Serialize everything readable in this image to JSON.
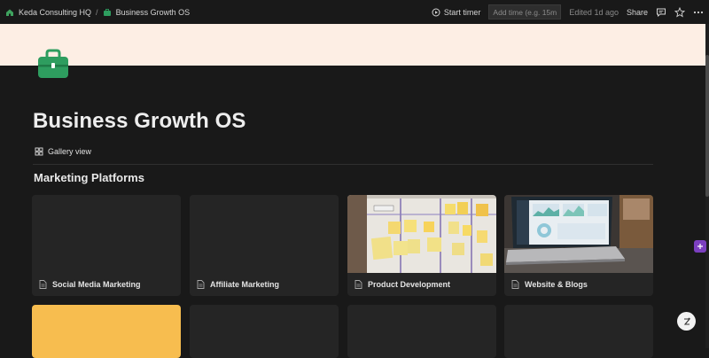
{
  "breadcrumb": {
    "workspace": "Keda Consulting HQ",
    "separator": "/",
    "page": "Business Growth OS"
  },
  "toolbar": {
    "start_timer": "Start timer",
    "time_placeholder": "Add time (e.g. 15m)",
    "edited": "Edited 1d ago",
    "share": "Share"
  },
  "page": {
    "title": "Business Growth OS",
    "view_label": "Gallery view",
    "section_title": "Marketing Platforms",
    "cover_color": "#fdeee4",
    "icon": "briefcase-icon",
    "icon_color": "#2e9d5f"
  },
  "cards": [
    {
      "title": "Social Media Marketing",
      "cover": "none"
    },
    {
      "title": "Affiliate Marketing",
      "cover": "none"
    },
    {
      "title": "Product Development",
      "cover": "whiteboard-sticky-notes-photo"
    },
    {
      "title": "Website & Blogs",
      "cover": "laptop-dashboard-photo"
    }
  ],
  "second_row": [
    {
      "cover_color": "#f7bd4f"
    },
    {
      "cover_color": "#252525"
    },
    {
      "cover_color": "#252525"
    },
    {
      "cover_color": "#252525"
    }
  ]
}
